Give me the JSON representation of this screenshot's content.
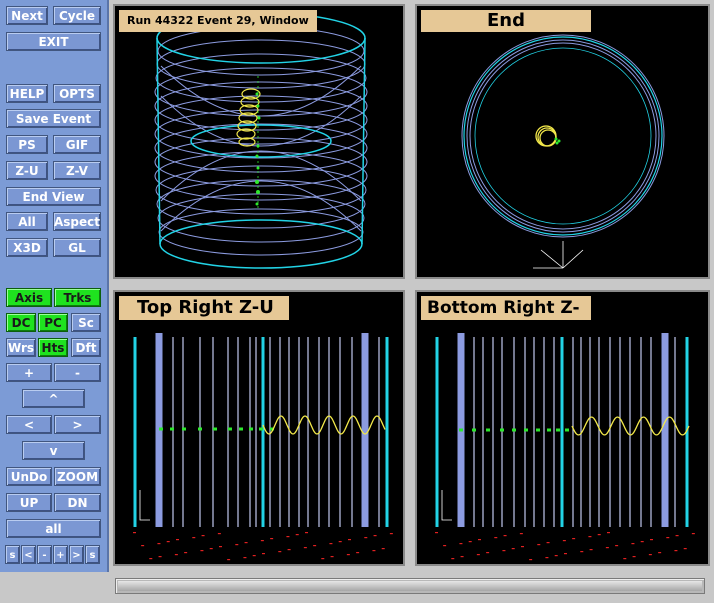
{
  "sidebar": {
    "buttons": {
      "next": "Next",
      "cycle": "Cycle",
      "exit": "EXIT",
      "help": "HELP",
      "opts": "OPTS",
      "save_event": "Save Event",
      "ps": "PS",
      "gif": "GIF",
      "zu": "Z-U",
      "zv": "Z-V",
      "end_view": "End View",
      "all": "All",
      "aspect": "Aspect",
      "x3d": "X3D",
      "gl": "GL",
      "axis": "Axis",
      "trks": "Trks",
      "dc": "DC",
      "pc": "PC",
      "sc": "Sc",
      "wrs": "Wrs",
      "hts": "Hts",
      "dft": "Dft",
      "plus": "+",
      "minus": "-",
      "up_arrow": "^",
      "left_arrow": "<",
      "right_arrow": ">",
      "down_arrow": "v",
      "undo": "UnDo",
      "zoom": "ZOOM",
      "up": "UP",
      "dn": "DN",
      "all_lower": "all",
      "bottom_row": [
        "s",
        "<",
        "-",
        "+",
        ">",
        "s"
      ]
    },
    "active_toggles": [
      "Axis",
      "Trks",
      "DC",
      "PC",
      "Hts"
    ]
  },
  "panels": {
    "top_left": {
      "title": "Run 44322 Event 29, Window"
    },
    "top_right": {
      "title": "End"
    },
    "bottom_left": {
      "title": "Top Right Z-U"
    },
    "bottom_right": {
      "title": "Bottom Right Z-V"
    }
  },
  "colors": {
    "sidebar_bg": "#7c9bd6",
    "toggle_on": "#1fe21f",
    "title_bg": "#e6c896",
    "panel_bg": "#000000",
    "detector_cyan": "#22d3e6",
    "detector_blue": "#8c9be0",
    "track_yellow": "#f2e84a",
    "hit_green": "#2ee82e",
    "hit_red": "#e02020"
  }
}
